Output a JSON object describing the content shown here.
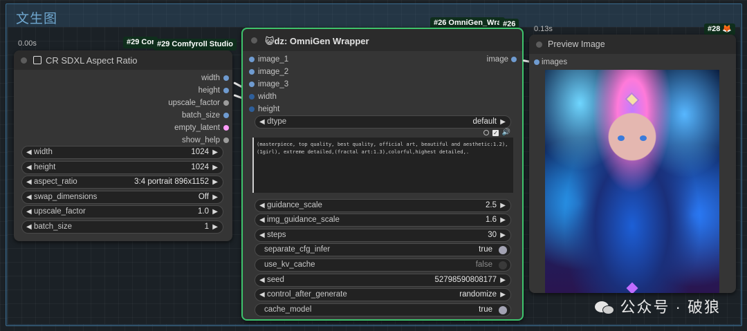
{
  "group": {
    "title": "文生图"
  },
  "node29": {
    "time": "0.00s",
    "badge_short": "#29 Cor",
    "badge_full": "#29 Comfyroll Studio",
    "title": "CR SDXL Aspect Ratio",
    "outputs": [
      "width",
      "height",
      "upscale_factor",
      "batch_size",
      "empty_latent",
      "show_help"
    ],
    "widgets": [
      {
        "label": "width",
        "value": "1024"
      },
      {
        "label": "height",
        "value": "1024"
      },
      {
        "label": "aspect_ratio",
        "value": "3:4 portrait 896x1152"
      },
      {
        "label": "swap_dimensions",
        "value": "Off"
      },
      {
        "label": "upscale_factor",
        "value": "1.0"
      },
      {
        "label": "batch_size",
        "value": "1"
      }
    ]
  },
  "node26": {
    "badge": "#26 OmniGen_Wra",
    "badge_id": "#26",
    "title": "😺dz: OmniGen Wrapper",
    "inputs": [
      "image_1",
      "image_2",
      "image_3",
      "width",
      "height"
    ],
    "output": "image",
    "dtype": {
      "label": "dtype",
      "value": "default"
    },
    "prompt": "(masterpiece, top quality, best quality, official art, beautiful and aesthetic:1.2), (1girl), extreme detailed,(fractal art:1.3),colorful,highest detailed,.",
    "widgets": [
      {
        "label": "guidance_scale",
        "value": "2.5"
      },
      {
        "label": "img_guidance_scale",
        "value": "1.6"
      },
      {
        "label": "steps",
        "value": "30"
      }
    ],
    "toggles": [
      {
        "label": "separate_cfg_infer",
        "value": "true"
      },
      {
        "label": "use_kv_cache",
        "value": "false"
      }
    ],
    "widgets2": [
      {
        "label": "seed",
        "value": "52798590808177"
      },
      {
        "label": "control_after_generate",
        "value": "randomize"
      }
    ],
    "cache": {
      "label": "cache_model",
      "value": "true"
    }
  },
  "node28": {
    "time": "0.13s",
    "badge": "#28 🦊",
    "title": "Preview Image",
    "input": "images"
  },
  "watermark": "公众号 · 破狼",
  "colors": {
    "accent_green": "#3ec46d",
    "port_blue": "#6f9bd0",
    "latent_pink": "#ff9cf9"
  }
}
